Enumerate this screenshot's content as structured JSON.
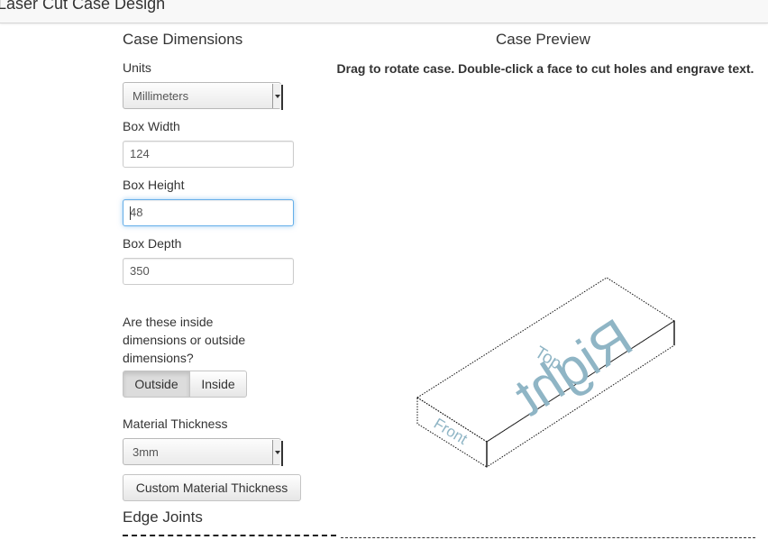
{
  "app": {
    "title": "Laser Cut Case Design"
  },
  "dimensions": {
    "heading": "Case Dimensions",
    "units_label": "Units",
    "units_value": "Millimeters",
    "width_label": "Box Width",
    "width_value": "124",
    "height_label": "Box Height",
    "height_value": "48",
    "depth_label": "Box Depth",
    "depth_value": "350",
    "question": "Are these inside dimensions or outside dimensions?",
    "outside_label": "Outside",
    "inside_label": "Inside",
    "thickness_label": "Material Thickness",
    "thickness_value": "3mm",
    "custom_thickness_label": "Custom Material Thickness",
    "edge_joints_heading": "Edge Joints"
  },
  "preview": {
    "heading": "Case Preview",
    "hint": "Drag to rotate case. Double-click a face to cut holes and engrave text.",
    "faces": {
      "top": "Top",
      "front": "Front",
      "right": "Right"
    },
    "colors": {
      "face_label": "#8fb5c5",
      "edge": "#111111"
    }
  }
}
